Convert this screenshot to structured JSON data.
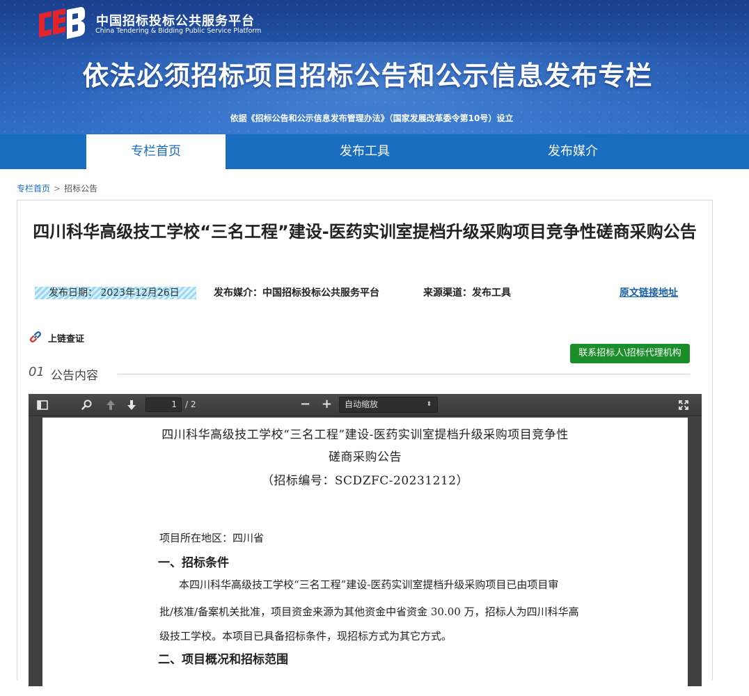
{
  "header": {
    "site_name": "中国招标投标公共服务平台",
    "site_name_en": "China Tendering & Bidding Public Service Platform",
    "title": "依法必须招标项目招标公告和公示信息发布专栏",
    "subtitle": "依据《招标公告和公示信息发布管理办法》（国家发展改革委令第10号）设立"
  },
  "nav": {
    "items": [
      {
        "label": "专栏首页",
        "active": true
      },
      {
        "label": "发布工具",
        "active": false
      },
      {
        "label": "发布媒介",
        "active": false
      }
    ]
  },
  "breadcrumb": {
    "home": "专栏首页",
    "separator": ">",
    "current": "招标公告"
  },
  "article": {
    "title": "四川科华高级技工学校“三名工程”建设-医药实训室提档升级采购项目竞争性磋商采购公告",
    "publish_date": "发布日期： 2023年12月26日",
    "media": "发布媒介：中国招标投标公共服务平台",
    "source": "来源渠道：发布工具",
    "original_link": "原文链接地址",
    "chain_label": "上链查证",
    "contact_button": "联系招标人\\招标代理机构",
    "section_num": "01",
    "section_label": "公告内容"
  },
  "viewer": {
    "page_current": "1",
    "page_total": "/ 2",
    "zoom": "自动缩放",
    "zoom_out": "−",
    "zoom_in": "+"
  },
  "document": {
    "title_line1": "四川科华高级技工学校“三名工程”建设-医药实训室提档升级采购项目竞争性",
    "title_line2": "磋商采购公告",
    "code": "（招标编号：SCDZFC-20231212）",
    "region": "项目所在地区：四川省",
    "heading1": "一、招标条件",
    "para1_line1": "本四川科华高级技工学校“三名工程”建设-医药实训室提档升级采购项目已由项目审",
    "para1_line2": "批/核准/备案机关批准，项目资金来源为其他资金中省资金 30.00 万，招标人为四川科华高",
    "para1_line3": "级技工学校。本项目已具备招标条件，现招标方式为其它方式。",
    "heading2": "二、项目概况和招标范围"
  },
  "colors": {
    "nav_blue": "#1a6ec2",
    "button_green": "#1b8e2a",
    "link_blue": "#1a5fa8"
  }
}
